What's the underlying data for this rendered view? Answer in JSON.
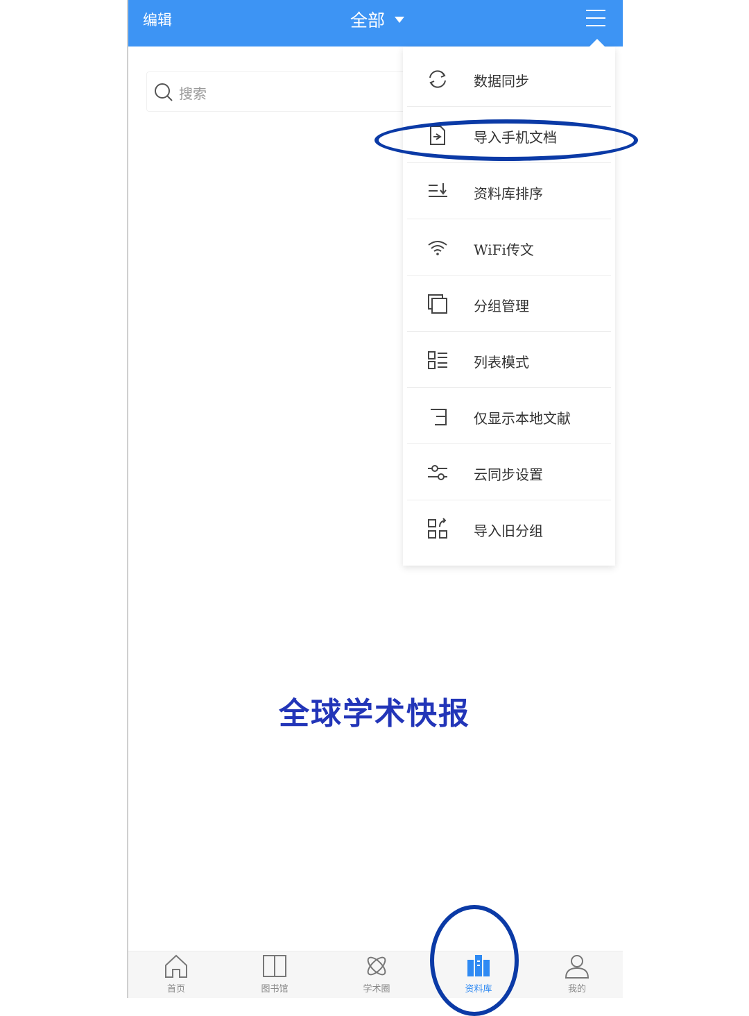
{
  "topbar": {
    "edit_label": "编辑",
    "filter_label": "全部",
    "accent": "#3d94f4"
  },
  "search": {
    "placeholder": "搜索"
  },
  "menu": {
    "items": [
      {
        "label": "数据同步",
        "icon": "sync-icon"
      },
      {
        "label": "导入手机文档",
        "icon": "import-file-icon"
      },
      {
        "label": "资料库排序",
        "icon": "sort-icon"
      },
      {
        "label": "WiFi传文",
        "icon": "wifi-icon"
      },
      {
        "label": "分组管理",
        "icon": "group-icon"
      },
      {
        "label": "列表模式",
        "icon": "list-mode-icon"
      },
      {
        "label": "仅显示本地文献",
        "icon": "local-only-icon"
      },
      {
        "label": "云同步设置",
        "icon": "settings-sliders-icon"
      },
      {
        "label": "导入旧分组",
        "icon": "import-group-icon"
      }
    ]
  },
  "headline": "全球学术快报",
  "tabbar": {
    "tabs": [
      {
        "label": "首页",
        "icon": "home-icon"
      },
      {
        "label": "图书馆",
        "icon": "book-icon"
      },
      {
        "label": "学术圈",
        "icon": "atom-icon"
      },
      {
        "label": "资料库",
        "icon": "library-icon",
        "active": true
      },
      {
        "label": "我的",
        "icon": "user-icon"
      }
    ],
    "active_color": "#2f8af3"
  }
}
